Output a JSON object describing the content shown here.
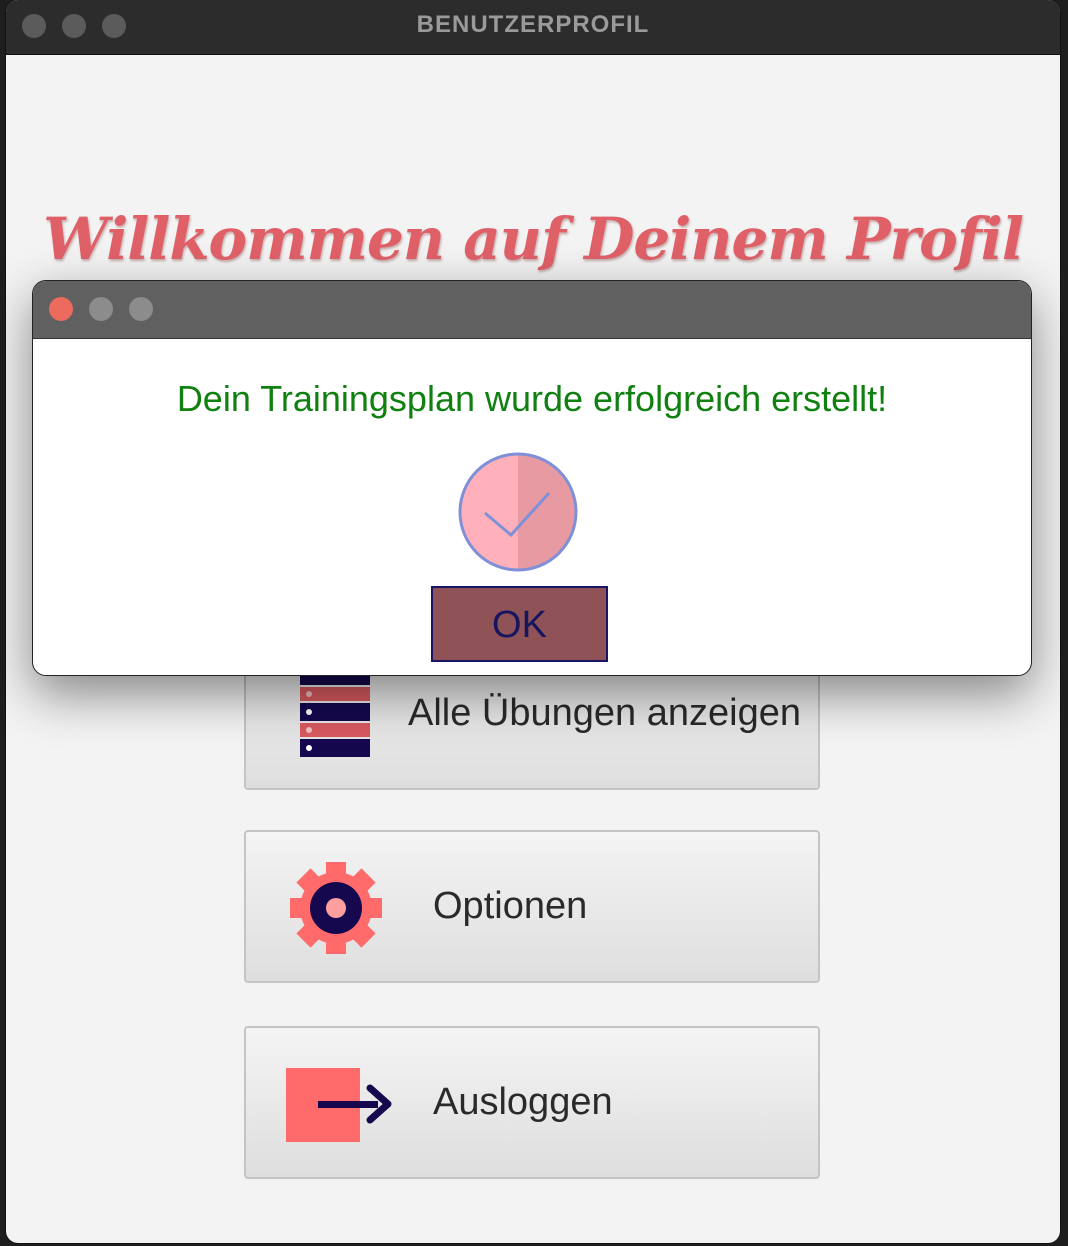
{
  "window": {
    "title": "BENUTZERPROFIL"
  },
  "main": {
    "welcome": "Willkommen auf Deinem Profil",
    "buttons": [
      {
        "label": "Alle Übungen anzeigen",
        "icon": "list-icon"
      },
      {
        "label": "Optionen",
        "icon": "gear-icon"
      },
      {
        "label": "Ausloggen",
        "icon": "logout-icon"
      }
    ]
  },
  "dialog": {
    "message": "Dein Trainingsplan wurde erfolgreich erstellt!",
    "icon": "checkmark-icon",
    "ok_label": "OK"
  },
  "colors": {
    "accent": "#e06068",
    "success_text": "#108010",
    "ok_button": "#8e5257",
    "icon_navy": "#15084f",
    "icon_coral": "#ff6b6b"
  }
}
